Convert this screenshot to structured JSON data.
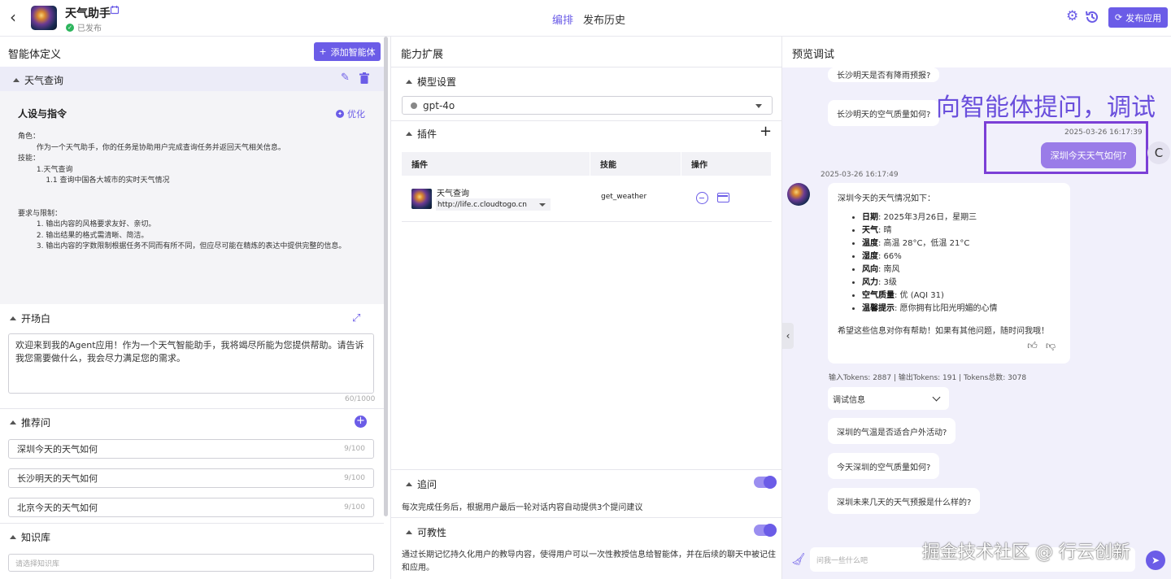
{
  "header": {
    "back_icon": "chevron-left-icon",
    "app_name": "天气助手",
    "status": "已发布",
    "tabs": [
      {
        "label": "编排",
        "active": true
      },
      {
        "label": "发布历史",
        "active": false
      }
    ],
    "publish_label": "发布应用"
  },
  "agent_def": {
    "title": "智能体定义",
    "add_button": "添加智能体",
    "persona_section": "天气查询",
    "persona_title": "人设与指令",
    "optimize_label": "优化",
    "persona_text": "角色：\n        作为一个天气助手，你的任务是协助用户完成查询任务并返回天气相关信息。\n技能：\n        1.天气查询\n            1.1 查询中国各大城市的实时天气情况\n\n\n要求与限制：\n        1. 输出内容的风格要求友好、亲切。\n        2. 输出结果的格式需清晰、简洁。\n        3. 输出内容的字数限制根据任务不同而有所不同，但应尽可能在精炼的表达中提供完整的信息。",
    "opening_title": "开场白",
    "opening_text": "欢迎来到我的Agent应用！作为一个天气智能助手，我将竭尽所能为您提供帮助。请告诉我您需要做什么，我会尽力满足您的需求。",
    "opening_count": "60/1000",
    "suggest_title": "推荐问",
    "suggestions": [
      {
        "text": "深圳今天的天气如何",
        "count": "9/100"
      },
      {
        "text": "长沙明天的天气如何",
        "count": "9/100"
      },
      {
        "text": "北京今天的天气如何",
        "count": "9/100"
      }
    ],
    "kb_title": "知识库",
    "kb_placeholder": "请选择知识库"
  },
  "capabilities": {
    "title": "能力扩展",
    "model_title": "模型设置",
    "model_value": "gpt-4o",
    "plugin_title": "插件",
    "table_headers": [
      "插件",
      "技能",
      "操作"
    ],
    "plugin_row": {
      "name": "天气查询",
      "url": "http://life.c.cloudtogo.cn",
      "skill": "get_weather"
    },
    "followup_title": "追问",
    "followup_on": true,
    "followup_desc": "每次完成任务后，根据用户最后一轮对话内容自动提供3个提问建议",
    "teach_title": "可教性",
    "teach_on": true,
    "teach_desc": "通过长期记忆持久化用户的教导内容，使得用户可以一次性教授信息给智能体，并在后续的聊天中被记住和应用。"
  },
  "preview": {
    "title": "预览调试",
    "prev_chip_cut": "长沙明天是否有降雨预报?",
    "prev_chip": "长沙明天的空气质量如何?",
    "overlay_text": "向智能体提问，调试",
    "user_time": "2025-03-26 16:17:39",
    "user_message": "深圳今天天气如何?",
    "user_avatar": "C",
    "bot_time": "2025-03-26 16:17:49",
    "answer_intro": "深圳今天的天气情况如下：",
    "answer_items": [
      {
        "label": "日期",
        "value": ": 2025年3月26日，星期三"
      },
      {
        "label": "天气",
        "value": ": 晴"
      },
      {
        "label": "温度",
        "value": ": 高温 28°C，低温 21°C"
      },
      {
        "label": "湿度",
        "value": ": 66%"
      },
      {
        "label": "风向",
        "value": ": 南风"
      },
      {
        "label": "风力",
        "value": ": 3级"
      },
      {
        "label": "空气质量",
        "value": ": 优 (AQI 31)"
      },
      {
        "label": "温馨提示",
        "value": ": 愿你拥有比阳光明媚的心情"
      }
    ],
    "answer_outro": "希望这些信息对你有帮助！如果有其他问题，随时问我哦！",
    "tokens": "输入Tokens: 2887 |   输出Tokens: 191 |   Tokens总数: 3078",
    "debug_label": "调试信息",
    "followups": [
      "深圳的气温是否适合户外活动?",
      "今天深圳的空气质量如何?",
      "深圳未来几天的天气预报是什么样的?"
    ],
    "input_placeholder": "问我一些什么吧",
    "watermark": "掘金技术社区 @ 行云创新"
  }
}
